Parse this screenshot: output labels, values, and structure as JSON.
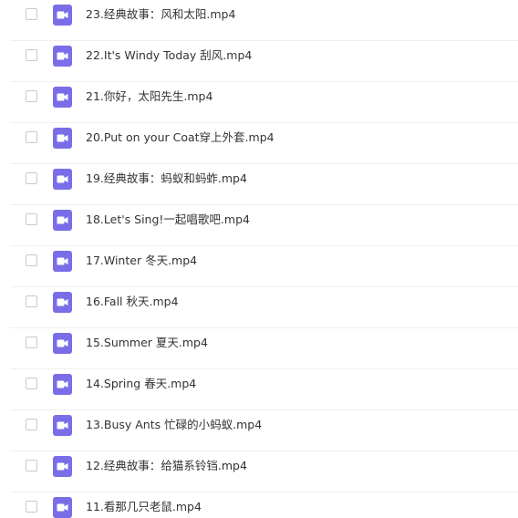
{
  "colors": {
    "icon_bg": "#7a6ee8",
    "icon_glyph": "#ffffff",
    "text": "#333333",
    "divider": "#efefef",
    "checkbox_border": "#c9c9c9"
  },
  "icon_name": "video-file-icon",
  "files": [
    {
      "name": "23.经典故事：风和太阳.mp4"
    },
    {
      "name": "22.It's Windy Today 刮风.mp4"
    },
    {
      "name": "21.你好，太阳先生.mp4"
    },
    {
      "name": "20.Put on your Coat穿上外套.mp4"
    },
    {
      "name": "19.经典故事：蚂蚁和蚂蚱.mp4"
    },
    {
      "name": "18.Let's Sing!一起唱歌吧.mp4"
    },
    {
      "name": "17.Winter 冬天.mp4"
    },
    {
      "name": "16.Fall 秋天.mp4"
    },
    {
      "name": "15.Summer 夏天.mp4"
    },
    {
      "name": "14.Spring 春天.mp4"
    },
    {
      "name": "13.Busy Ants 忙碌的小蚂蚁.mp4"
    },
    {
      "name": "12.经典故事：给猫系铃铛.mp4"
    },
    {
      "name": "11.看那几只老鼠.mp4"
    }
  ]
}
